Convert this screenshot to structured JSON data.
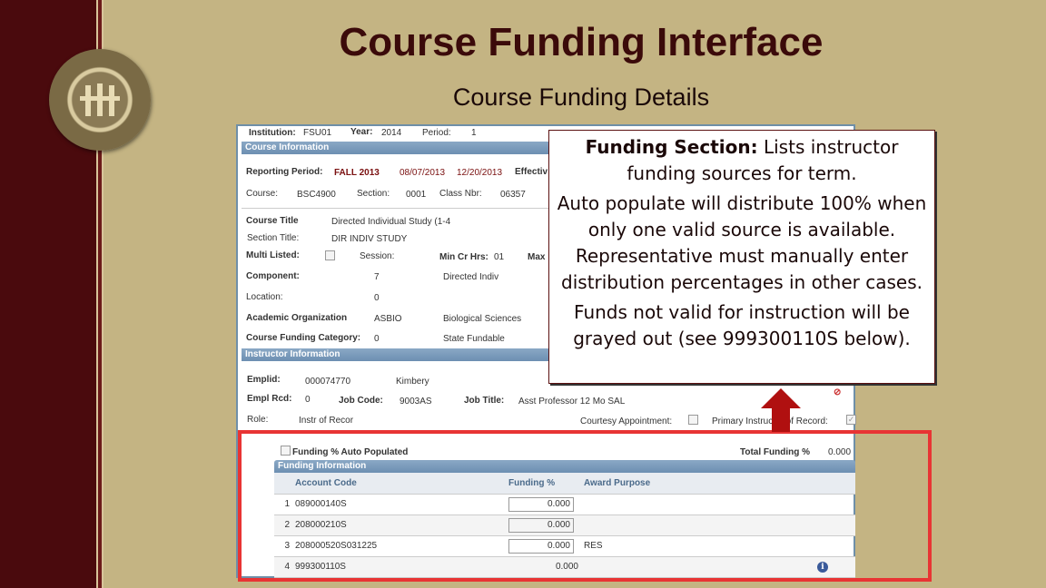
{
  "slide": {
    "title": "Course Funding Interface",
    "subtitle": "Course Funding Details",
    "logo_text": "FLORIDA STATE UNIVERSITY 1851"
  },
  "top": {
    "institution_label": "Institution:",
    "institution": "FSU01",
    "year_label": "Year:",
    "year": "2014",
    "period_label": "Period:",
    "period": "1"
  },
  "course": {
    "header": "Course Information",
    "reporting_label": "Reporting Period:",
    "reporting": "FALL 2013",
    "start": "08/07/2013",
    "end": "12/20/2013",
    "effective_label": "Effectiv",
    "course_label": "Course:",
    "course": "BSC4900",
    "section_label": "Section:",
    "section": "0001",
    "classnbr_label": "Class Nbr:",
    "classnbr": "06357",
    "title_label": "Course Title",
    "title": "Directed Individual Study (1-4",
    "section_title_label": "Section Title:",
    "section_title": "DIR INDIV STUDY",
    "multi_label": "Multi Listed:",
    "session_label": "Session:",
    "mincr_label": "Min Cr Hrs:",
    "mincr": "01",
    "max_label": "Max",
    "component_label": "Component:",
    "component": "7",
    "component_desc": "Directed Indiv",
    "location_label": "Location:",
    "location": "0",
    "org_label": "Academic Organization",
    "org": "ASBIO",
    "org_desc": "Biological Sciences",
    "cat_label": "Course Funding Category:",
    "cat": "0",
    "cat_desc": "State Fundable"
  },
  "instructor": {
    "header": "Instructor Information",
    "emplid_label": "Emplid:",
    "emplid": "000074770",
    "name": "Kimbery",
    "rcd_label": "Empl Rcd:",
    "rcd": "0",
    "jobcode_label": "Job Code:",
    "jobcode": "9003AS",
    "jobtitle_label": "Job Title:",
    "jobtitle": "Asst Professor 12 Mo SAL",
    "role_label": "Role:",
    "role": "Instr of Recor",
    "courtesy_label": "Courtesy Appointment:",
    "primary_label": "Primary Instructor of Record:"
  },
  "funding": {
    "auto_label": "Funding % Auto Populated",
    "total_label": "Total Funding %",
    "total": "0.000",
    "header": "Funding Information",
    "columns": [
      "Account Code",
      "Funding %",
      "Award Purpose"
    ],
    "rows": [
      {
        "n": "1",
        "code": "089000140S",
        "pct": "0.000",
        "purpose": ""
      },
      {
        "n": "2",
        "code": "208000210S",
        "pct": "0.000",
        "purpose": ""
      },
      {
        "n": "3",
        "code": "208000520S031225",
        "pct": "0.000",
        "purpose": "RES"
      },
      {
        "n": "4",
        "code": "999300110S",
        "pct": "0.000",
        "purpose": ""
      }
    ]
  },
  "callout": {
    "bold": "Funding Section:",
    "line1": " Lists instructor funding sources for term.",
    "line2": "Auto populate will distribute 100% when only one valid source is available. Representative must manually enter distribution percentages in other cases.",
    "line3": "Funds not valid for instruction will be grayed out (see 999300110S below)."
  },
  "colors": {
    "maroon": "#4a0a0d",
    "gold": "#c4b483",
    "highlight": "#e83434"
  }
}
